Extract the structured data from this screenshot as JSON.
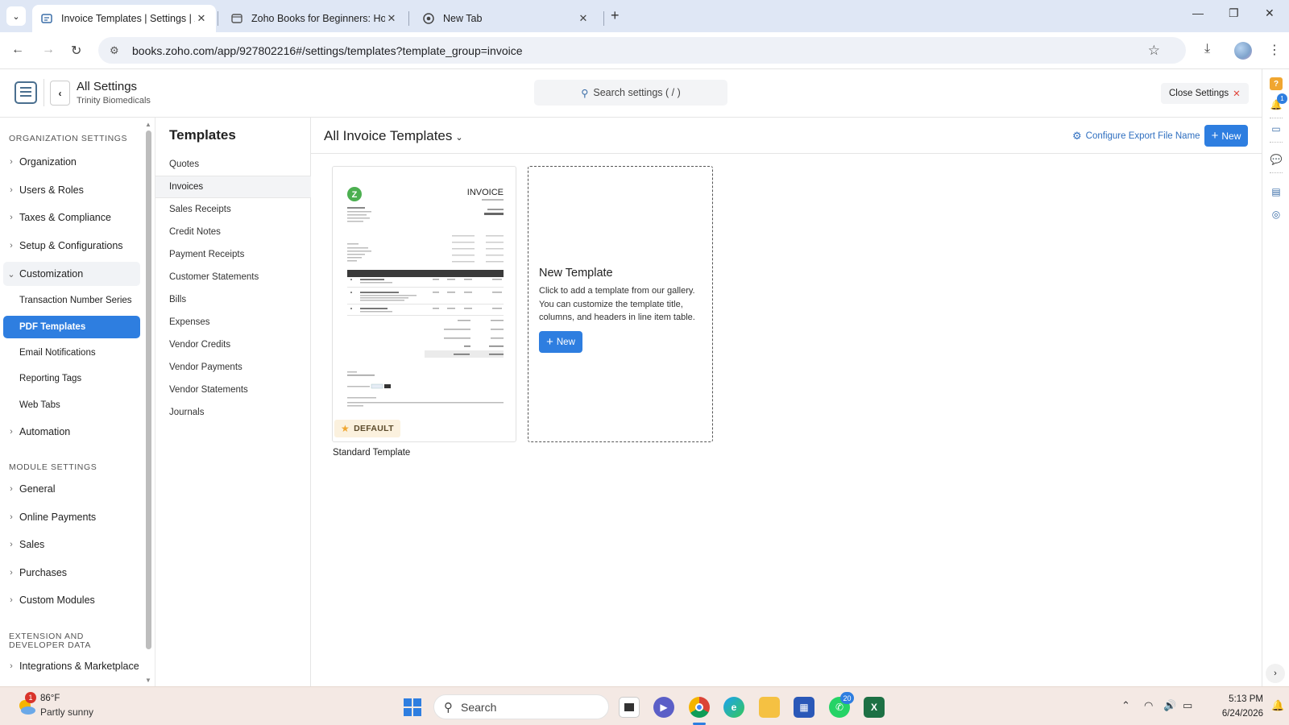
{
  "browser": {
    "tabs": [
      {
        "title": "Invoice Templates | Settings | Zoho",
        "active": true
      },
      {
        "title": "Zoho Books for Beginners: How",
        "active": false
      },
      {
        "title": "New Tab",
        "active": false
      }
    ],
    "url": "books.zoho.com/app/927802216#/settings/templates?template_group=invoice"
  },
  "header": {
    "title": "All Settings",
    "org": "Trinity Biomedicals",
    "search_placeholder": "Search settings ( / )",
    "close_label": "Close Settings"
  },
  "leftnav": {
    "org_section": "ORGANIZATION SETTINGS",
    "org_items": [
      "Organization",
      "Users & Roles",
      "Taxes & Compliance",
      "Setup & Configurations"
    ],
    "customization": "Customization",
    "custom_sub": [
      "Transaction Number Series",
      "PDF Templates",
      "Email Notifications",
      "Reporting Tags",
      "Web Tabs"
    ],
    "automation": "Automation",
    "module_section": "MODULE SETTINGS",
    "module_items": [
      "General",
      "Online Payments",
      "Sales",
      "Purchases",
      "Custom Modules"
    ],
    "ext_section_1": "EXTENSION AND",
    "ext_section_2": "DEVELOPER DATA",
    "ext_items": [
      "Integrations & Marketplace"
    ]
  },
  "templates_nav": {
    "title": "Templates",
    "items": [
      "Quotes",
      "Invoices",
      "Sales Receipts",
      "Credit Notes",
      "Payment Receipts",
      "Customer Statements",
      "Bills",
      "Expenses",
      "Vendor Credits",
      "Vendor Payments",
      "Vendor Statements",
      "Journals"
    ],
    "active_index": 1
  },
  "main": {
    "title": "All Invoice Templates",
    "configure_label": "Configure Export File Name",
    "new_label": "New",
    "card": {
      "preview_heading": "INVOICE",
      "badge": "DEFAULT",
      "caption": "Standard Template"
    },
    "new_card": {
      "title": "New Template",
      "description": "Click to add a template from our gallery. You can customize the template title, columns, and headers in line item table.",
      "button": "New"
    }
  },
  "taskbar": {
    "weather_temp": "86°F",
    "weather_desc": "Partly sunny",
    "weather_badge": "1",
    "search_label": "Search",
    "whatsapp_badge": "20",
    "time": "5:13 PM",
    "date": "6/24/2026"
  },
  "rightbar": {
    "notification_count": "1"
  },
  "colors": {
    "accent": "#2e7ee0",
    "tabbar": "#dfe7f5",
    "taskbar": "#f4e9e4",
    "badge_bg": "#fbf1de"
  }
}
